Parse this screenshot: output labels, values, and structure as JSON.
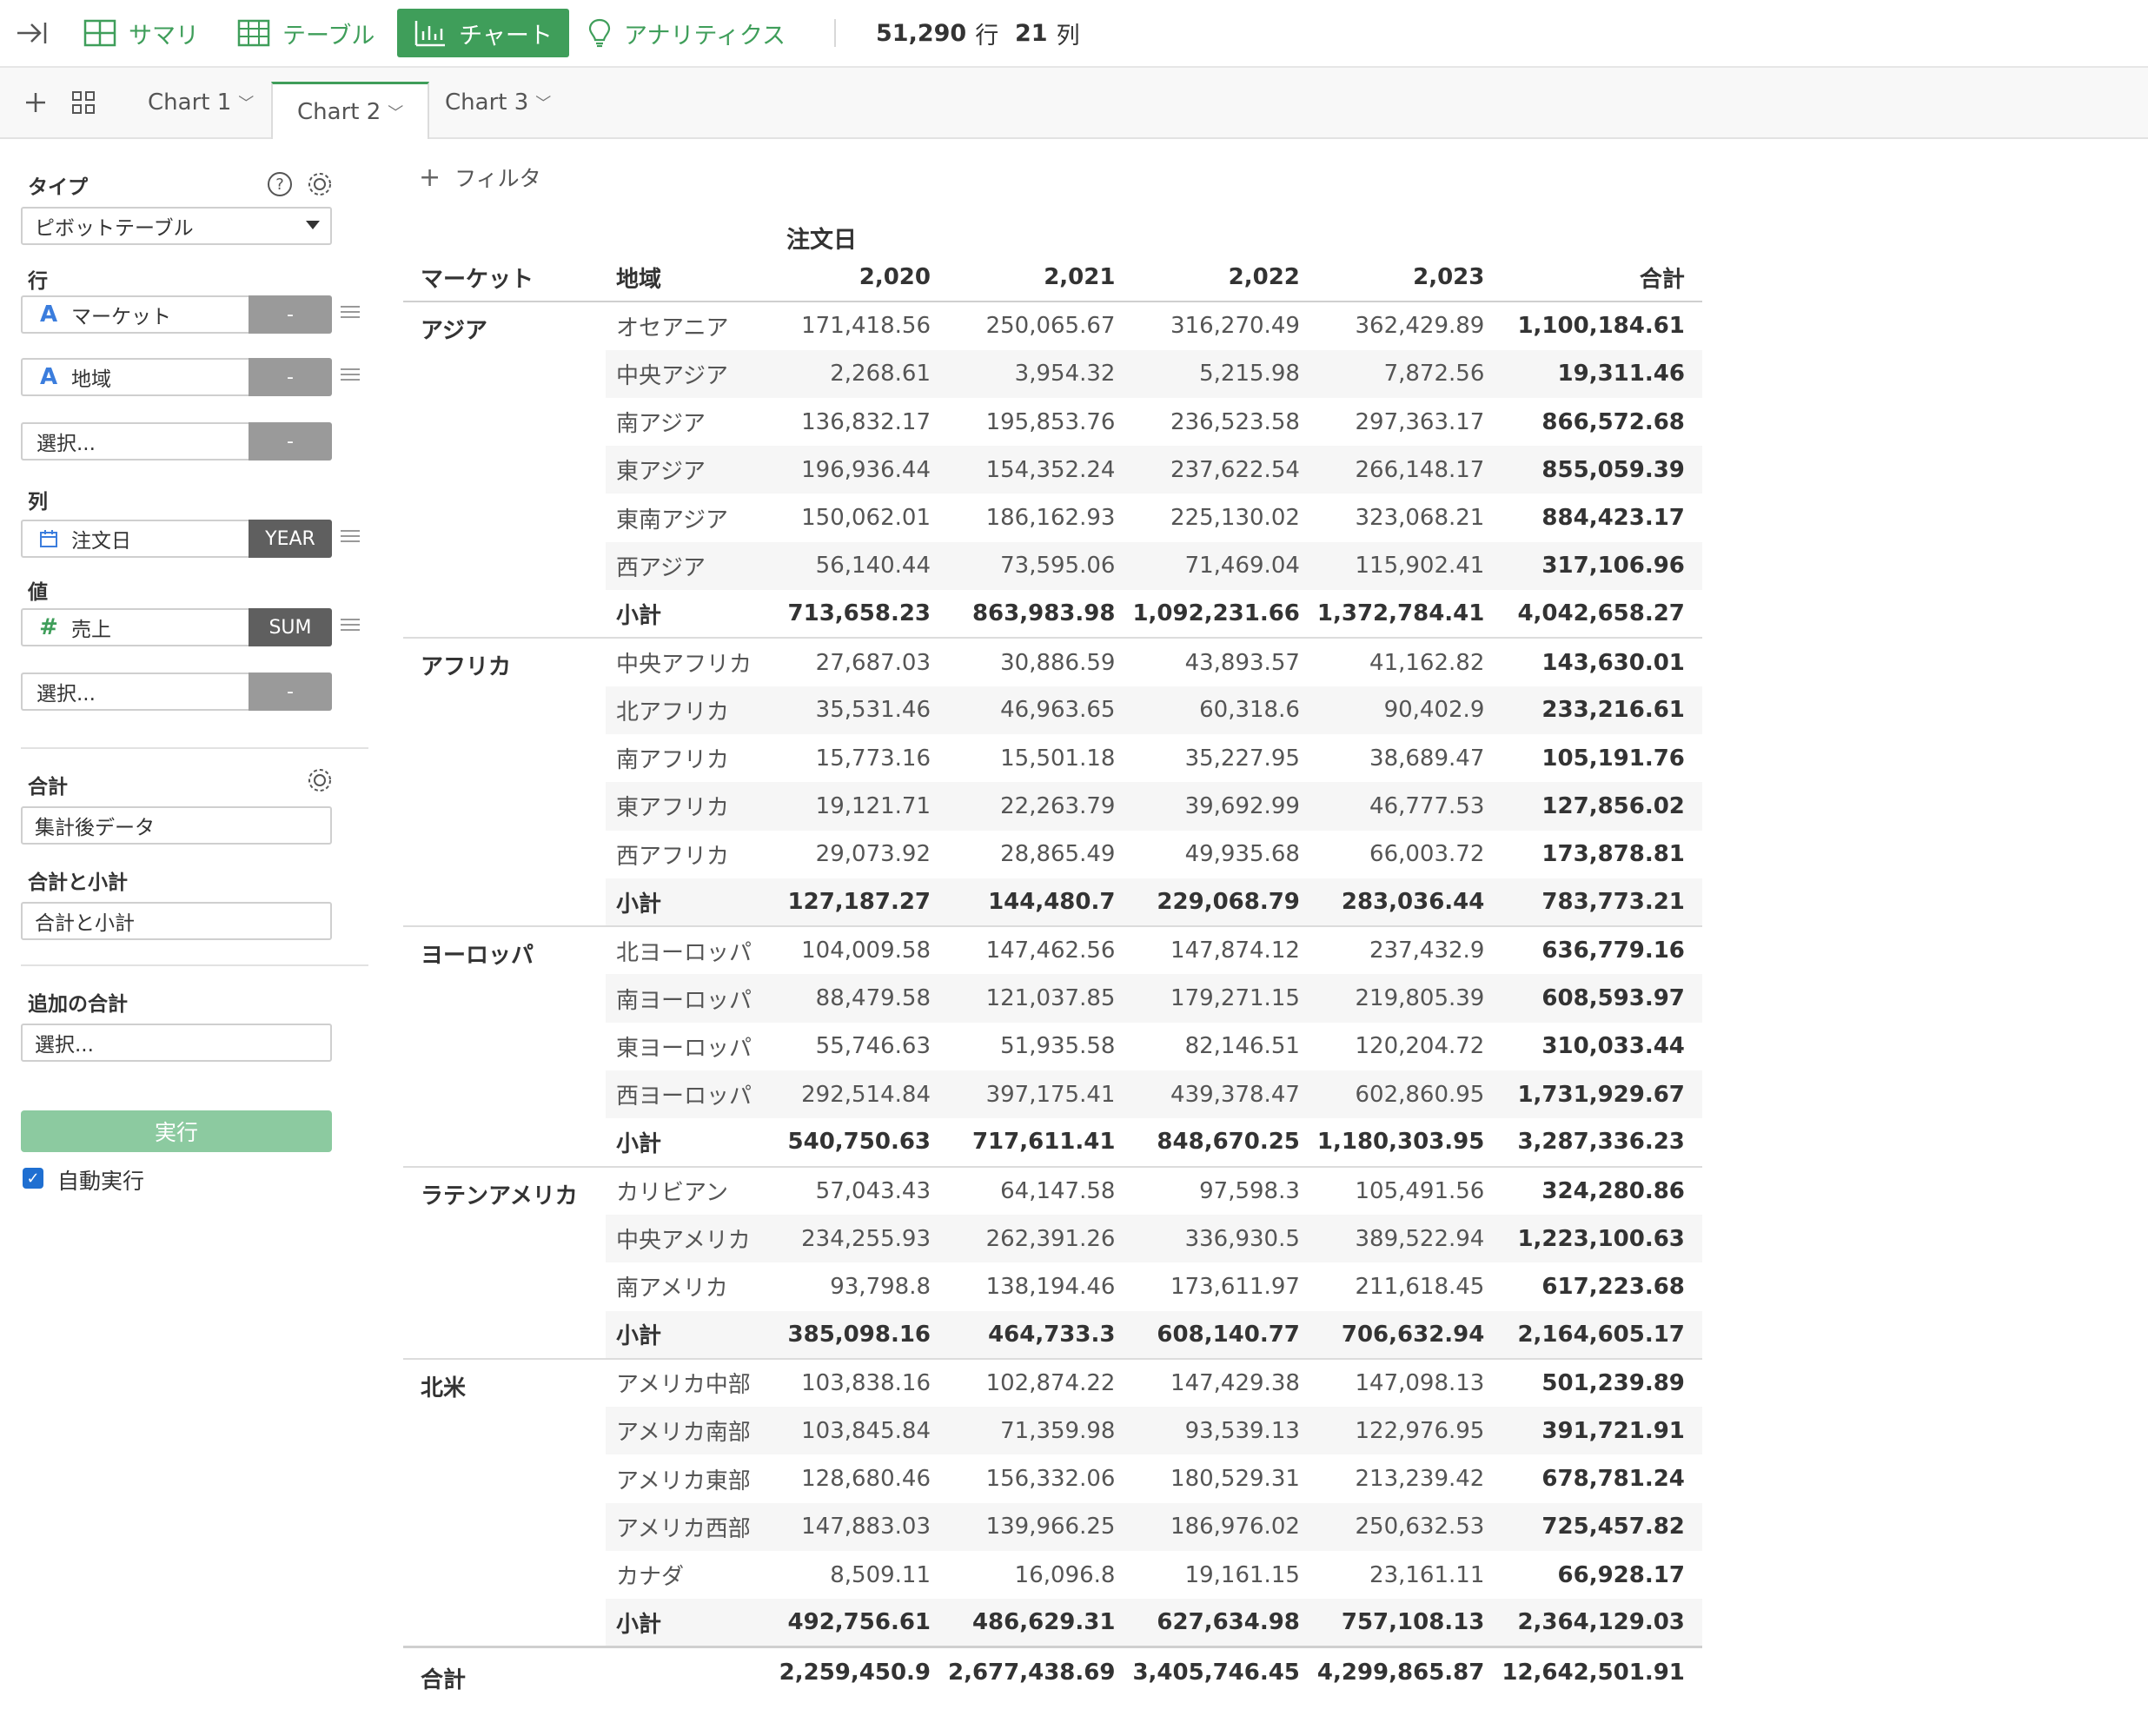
{
  "toolbar": {
    "summary": "サマリ",
    "table": "テーブル",
    "chart": "チャート",
    "analytics": "アナリティクス",
    "rows_count": "51,290",
    "rows_unit": "行",
    "cols_count": "21",
    "cols_unit": "列"
  },
  "tabs": [
    {
      "label": "Chart 1",
      "active": false
    },
    {
      "label": "Chart 2",
      "active": true
    },
    {
      "label": "Chart 3",
      "active": false
    }
  ],
  "left_panel": {
    "type_label": "タイプ",
    "type_value": "ピボットテーブル",
    "rows_label": "行",
    "rows": [
      {
        "icon": "A",
        "name": "マーケット",
        "mode": "-"
      },
      {
        "icon": "A",
        "name": "地域",
        "mode": "-"
      }
    ],
    "rows_placeholder": "選択...",
    "rows_placeholder_mode": "-",
    "cols_label": "列",
    "cols": [
      {
        "icon": "calendar-icon",
        "name": "注文日",
        "mode": "YEAR"
      }
    ],
    "values_label": "値",
    "values": [
      {
        "icon": "#",
        "name": "売上",
        "mode": "SUM"
      }
    ],
    "values_placeholder": "選択...",
    "values_placeholder_mode": "-",
    "total_label": "合計",
    "total_value": "集計後データ",
    "subtotal_label": "合計と小計",
    "subtotal_value": "合計と小計",
    "extra_label": "追加の合計",
    "extra_placeholder": "選択...",
    "run_button": "実行",
    "auto_run_label": "自動実行",
    "auto_run_checked": true
  },
  "pivot": {
    "filter_label": "フィルタ",
    "column_group": "注文日",
    "headers": [
      "マーケット",
      "地域",
      "2,020",
      "2,021",
      "2,022",
      "2,023",
      "合計"
    ],
    "groups": [
      {
        "market": "アジア",
        "rows": [
          [
            "オセアニア",
            "171,418.56",
            "250,065.67",
            "316,270.49",
            "362,429.89",
            "1,100,184.61"
          ],
          [
            "中央アジア",
            "2,268.61",
            "3,954.32",
            "5,215.98",
            "7,872.56",
            "19,311.46"
          ],
          [
            "南アジア",
            "136,832.17",
            "195,853.76",
            "236,523.58",
            "297,363.17",
            "866,572.68"
          ],
          [
            "東アジア",
            "196,936.44",
            "154,352.24",
            "237,622.54",
            "266,148.17",
            "855,059.39"
          ],
          [
            "東南アジア",
            "150,062.01",
            "186,162.93",
            "225,130.02",
            "323,068.21",
            "884,423.17"
          ],
          [
            "西アジア",
            "56,140.44",
            "73,595.06",
            "71,469.04",
            "115,902.41",
            "317,106.96"
          ]
        ],
        "subtotal": [
          "小計",
          "713,658.23",
          "863,983.98",
          "1,092,231.66",
          "1,372,784.41",
          "4,042,658.27"
        ]
      },
      {
        "market": "アフリカ",
        "rows": [
          [
            "中央アフリカ",
            "27,687.03",
            "30,886.59",
            "43,893.57",
            "41,162.82",
            "143,630.01"
          ],
          [
            "北アフリカ",
            "35,531.46",
            "46,963.65",
            "60,318.6",
            "90,402.9",
            "233,216.61"
          ],
          [
            "南アフリカ",
            "15,773.16",
            "15,501.18",
            "35,227.95",
            "38,689.47",
            "105,191.76"
          ],
          [
            "東アフリカ",
            "19,121.71",
            "22,263.79",
            "39,692.99",
            "46,777.53",
            "127,856.02"
          ],
          [
            "西アフリカ",
            "29,073.92",
            "28,865.49",
            "49,935.68",
            "66,003.72",
            "173,878.81"
          ]
        ],
        "subtotal": [
          "小計",
          "127,187.27",
          "144,480.7",
          "229,068.79",
          "283,036.44",
          "783,773.21"
        ]
      },
      {
        "market": "ヨーロッパ",
        "rows": [
          [
            "北ヨーロッパ",
            "104,009.58",
            "147,462.56",
            "147,874.12",
            "237,432.9",
            "636,779.16"
          ],
          [
            "南ヨーロッパ",
            "88,479.58",
            "121,037.85",
            "179,271.15",
            "219,805.39",
            "608,593.97"
          ],
          [
            "東ヨーロッパ",
            "55,746.63",
            "51,935.58",
            "82,146.51",
            "120,204.72",
            "310,033.44"
          ],
          [
            "西ヨーロッパ",
            "292,514.84",
            "397,175.41",
            "439,378.47",
            "602,860.95",
            "1,731,929.67"
          ]
        ],
        "subtotal": [
          "小計",
          "540,750.63",
          "717,611.41",
          "848,670.25",
          "1,180,303.95",
          "3,287,336.23"
        ]
      },
      {
        "market": "ラテンアメリカ",
        "rows": [
          [
            "カリビアン",
            "57,043.43",
            "64,147.58",
            "97,598.3",
            "105,491.56",
            "324,280.86"
          ],
          [
            "中央アメリカ",
            "234,255.93",
            "262,391.26",
            "336,930.5",
            "389,522.94",
            "1,223,100.63"
          ],
          [
            "南アメリカ",
            "93,798.8",
            "138,194.46",
            "173,611.97",
            "211,618.45",
            "617,223.68"
          ]
        ],
        "subtotal": [
          "小計",
          "385,098.16",
          "464,733.3",
          "608,140.77",
          "706,632.94",
          "2,164,605.17"
        ]
      },
      {
        "market": "北米",
        "rows": [
          [
            "アメリカ中部",
            "103,838.16",
            "102,874.22",
            "147,429.38",
            "147,098.13",
            "501,239.89"
          ],
          [
            "アメリカ南部",
            "103,845.84",
            "71,359.98",
            "93,539.13",
            "122,976.95",
            "391,721.91"
          ],
          [
            "アメリカ東部",
            "128,680.46",
            "156,332.06",
            "180,529.31",
            "213,239.42",
            "678,781.24"
          ],
          [
            "アメリカ西部",
            "147,883.03",
            "139,966.25",
            "186,976.02",
            "250,632.53",
            "725,457.82"
          ],
          [
            "カナダ",
            "8,509.11",
            "16,096.8",
            "19,161.15",
            "23,161.11",
            "66,928.17"
          ]
        ],
        "subtotal": [
          "小計",
          "492,756.61",
          "486,629.31",
          "627,634.98",
          "757,108.13",
          "2,364,129.03"
        ]
      }
    ],
    "grand_total": [
      "合計",
      "2,259,450.9",
      "2,677,438.69",
      "3,405,746.45",
      "4,299,865.87",
      "12,642,501.91"
    ]
  },
  "colors": {
    "accent": "#3f9e5a",
    "run_button": "#8ccaa0",
    "checkbox": "#1f6fd1"
  }
}
